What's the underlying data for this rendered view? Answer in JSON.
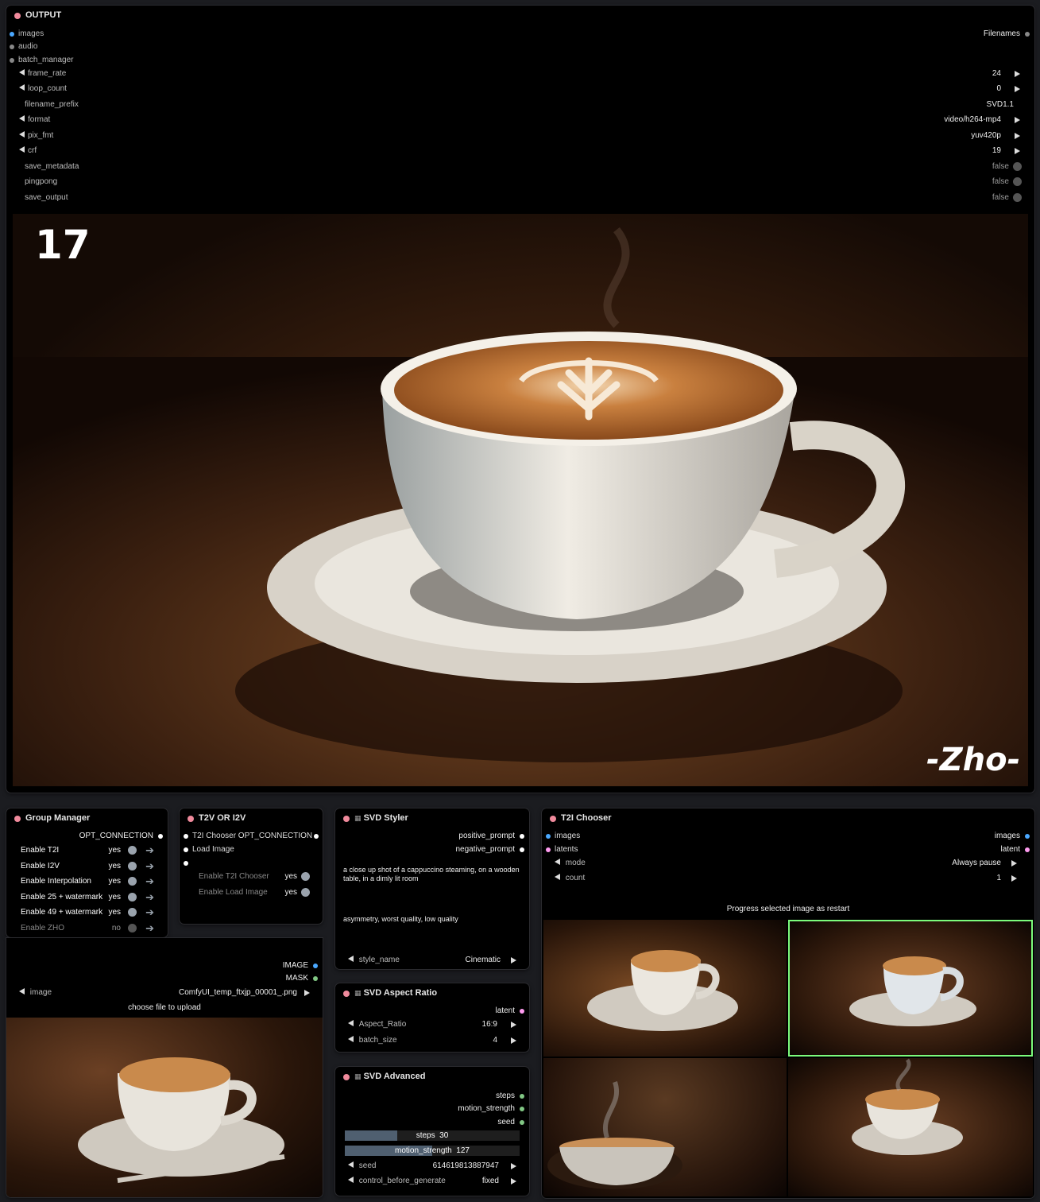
{
  "output_node": {
    "title": "OUTPUT",
    "inputs": [
      "images",
      "audio",
      "batch_manager"
    ],
    "output_label": "Filenames",
    "widgets": [
      {
        "label": "frame_rate",
        "value": "24",
        "arrows": true
      },
      {
        "label": "loop_count",
        "value": "0",
        "arrows": true
      },
      {
        "label": "filename_prefix",
        "value": "SVD1.1",
        "arrows": false
      },
      {
        "label": "format",
        "value": "video/h264-mp4",
        "arrows": true
      },
      {
        "label": "pix_fmt",
        "value": "yuv420p",
        "arrows": true
      },
      {
        "label": "crf",
        "value": "19",
        "arrows": true
      },
      {
        "label": "save_metadata",
        "value": "false",
        "toggle": true
      },
      {
        "label": "pingpong",
        "value": "false",
        "toggle": true
      },
      {
        "label": "save_output",
        "value": "false",
        "toggle": true
      }
    ],
    "preview_frame": "17",
    "preview_watermark": "-Zho-"
  },
  "group_manager": {
    "title": "Group Manager",
    "output": "OPT_CONNECTION",
    "items": [
      {
        "label": "Enable T2I",
        "value": "yes",
        "on": true
      },
      {
        "label": "Enable I2V",
        "value": "yes",
        "on": true
      },
      {
        "label": "Enable Interpolation",
        "value": "yes",
        "on": true
      },
      {
        "label": "Enable 25 + watermark",
        "value": "yes",
        "on": true
      },
      {
        "label": "Enable 49 + watermark",
        "value": "yes",
        "on": true
      },
      {
        "label": "Enable  ZHO",
        "value": "no",
        "on": false
      }
    ]
  },
  "t2v_node": {
    "title": "T2V OR I2V",
    "outputs": [
      "T2I Chooser OPT_CONNECTION",
      "Load Image",
      ""
    ],
    "items": [
      {
        "label": "Enable T2I Chooser",
        "value": "yes"
      },
      {
        "label": "Enable Load Image",
        "value": "yes"
      }
    ]
  },
  "load_image": {
    "outputs": [
      "IMAGE",
      "MASK"
    ],
    "image_label": "image",
    "image_value": "ComfyUI_temp_ftxjp_00001_.png",
    "upload_label": "choose file to upload"
  },
  "svd_styler": {
    "title": "SVD Styler",
    "outputs": [
      "positive_prompt",
      "negative_prompt"
    ],
    "positive_text": "a close up shot of a cappuccino steaming, on a wooden table, in a dimly lit room",
    "negative_text": "asymmetry, worst quality, low quality",
    "style_label": "style_name",
    "style_value": "Cinematic"
  },
  "svd_aspect": {
    "title": "SVD Aspect Ratio",
    "output": "latent",
    "widgets": [
      {
        "label": "Aspect_Ratio",
        "value": "16:9"
      },
      {
        "label": "batch_size",
        "value": "4"
      }
    ]
  },
  "svd_advanced": {
    "title": "SVD Advanced",
    "outputs": [
      "steps",
      "motion_strength",
      "seed"
    ],
    "steps_label": "steps",
    "steps_value": "30",
    "steps_fill": 0.3,
    "motion_label": "motion_strength",
    "motion_value": "127",
    "motion_fill": 0.5,
    "seed_label": "seed",
    "seed_value": "614619813887947",
    "control_label": "control_before_generate",
    "control_value": "fixed"
  },
  "t2i_chooser": {
    "title": "T2I Chooser",
    "inputs": [
      "images",
      "latents"
    ],
    "outputs": [
      "images",
      "latent"
    ],
    "mode_label": "mode",
    "mode_value": "Always pause",
    "count_label": "count",
    "count_value": "1",
    "progress_label": "Progress selected image as restart"
  },
  "colors": {
    "title_dot": "#f08a9c",
    "image_socket": "#4aa8ff",
    "latent_socket": "#ff9cf0",
    "mask_socket": "#81c784",
    "selected_border": "#7cfc7c"
  }
}
